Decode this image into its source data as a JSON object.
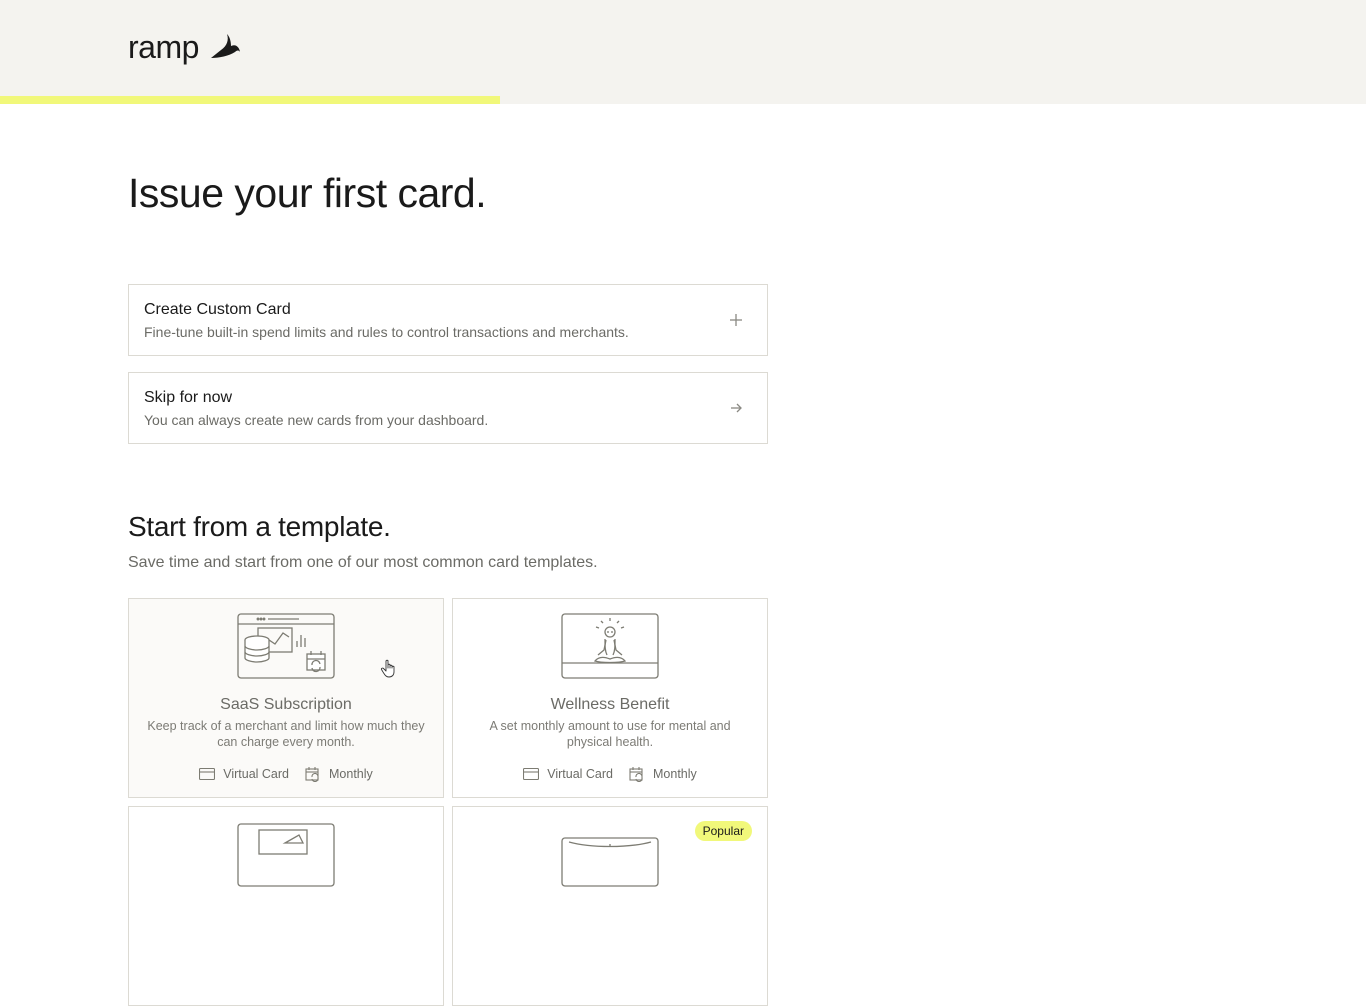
{
  "brand": {
    "name": "ramp",
    "accent": "#f1f87a",
    "top_bg": "#f4f3ef"
  },
  "progress": {
    "percent": 36.6
  },
  "page": {
    "title": "Issue your first card."
  },
  "options": [
    {
      "title": "Create Custom Card",
      "description": "Fine-tune built-in spend limits and rules to control transactions and merchants.",
      "icon": "plus-icon"
    },
    {
      "title": "Skip for now",
      "description": "You can always create new cards from your dashboard.",
      "icon": "arrow-right-icon"
    }
  ],
  "templates_section": {
    "title": "Start from a template.",
    "subtitle": "Save time and start from one of our most common card templates."
  },
  "templates": [
    {
      "title": "SaaS Subscription",
      "description": "Keep track of a merchant and limit how much they can charge every month.",
      "card_type": "Virtual Card",
      "frequency": "Monthly",
      "icon": "saas-dashboard-illustration"
    },
    {
      "title": "Wellness Benefit",
      "description": "A set monthly amount to use for mental and physical health.",
      "card_type": "Virtual Card",
      "frequency": "Monthly",
      "icon": "meditation-illustration"
    },
    {
      "title": "",
      "description": "",
      "icon": "laptop-illustration"
    },
    {
      "title": "",
      "description": "",
      "badge": "Popular",
      "icon": "monitor-illustration"
    }
  ]
}
